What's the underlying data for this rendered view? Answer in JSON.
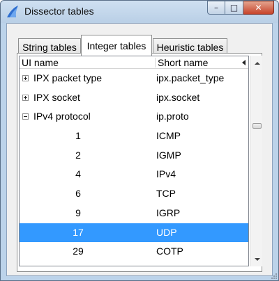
{
  "window": {
    "title": "Dissector tables",
    "controls": {
      "minimize": "–",
      "maximize": "□",
      "close": "✕"
    }
  },
  "tabs": [
    {
      "label": "String tables",
      "active": false
    },
    {
      "label": "Integer tables",
      "active": true
    },
    {
      "label": "Heuristic tables",
      "active": false
    }
  ],
  "table": {
    "columns": [
      "UI name",
      "Short name"
    ],
    "rows": [
      {
        "ui_name": "IPX packet type",
        "short_name": "ipx.packet_type",
        "expander": "collapsed"
      },
      {
        "ui_name": "IPX socket",
        "short_name": "ipx.socket",
        "expander": "collapsed"
      },
      {
        "ui_name": "IPv4 protocol",
        "short_name": "ip.proto",
        "expander": "expanded"
      },
      {
        "ui_name": "1",
        "short_name": "ICMP"
      },
      {
        "ui_name": "2",
        "short_name": "IGMP"
      },
      {
        "ui_name": "4",
        "short_name": "IPv4"
      },
      {
        "ui_name": "6",
        "short_name": "TCP"
      },
      {
        "ui_name": "9",
        "short_name": "IGRP"
      },
      {
        "ui_name": "17",
        "short_name": "UDP",
        "selected": true
      },
      {
        "ui_name": "29",
        "short_name": "COTP"
      }
    ]
  },
  "colors": {
    "selection": "#3399ff",
    "window_frame": "#bcd3ea",
    "close_button": "#c7432a"
  },
  "icons": {
    "app": "wireshark-fin-icon"
  }
}
